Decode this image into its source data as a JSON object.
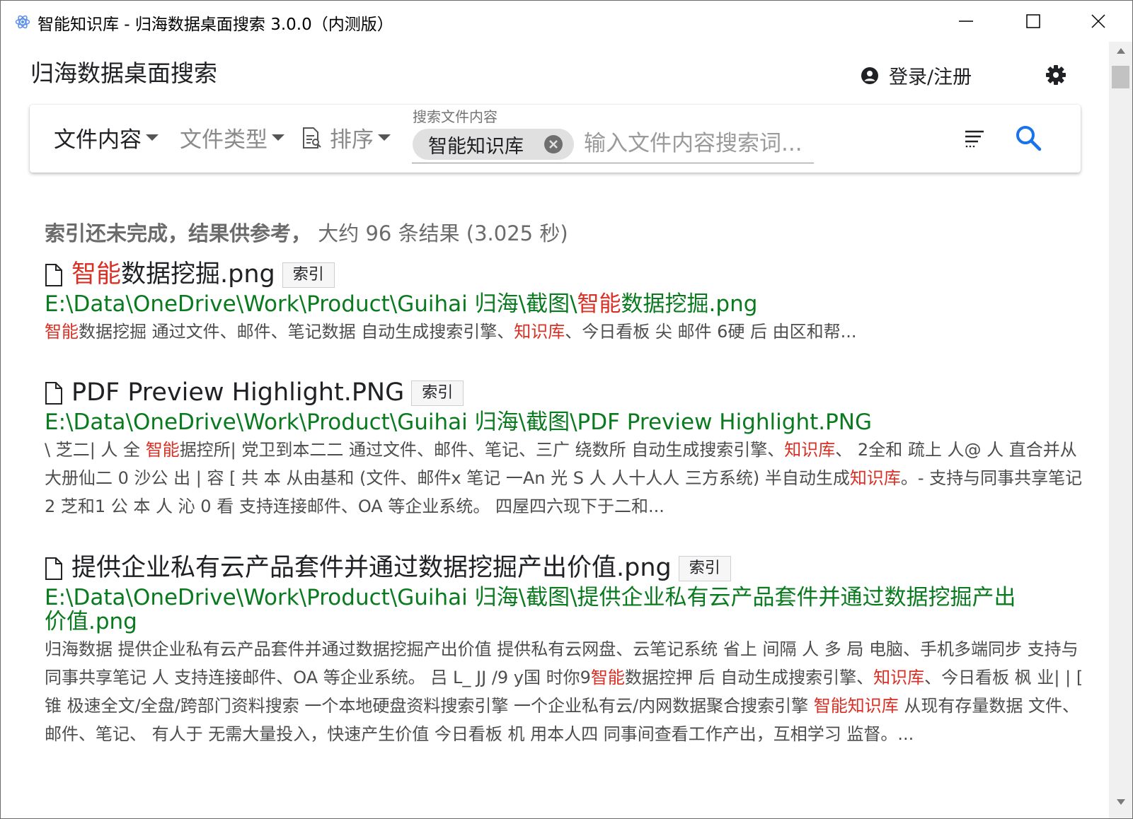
{
  "window": {
    "title": "智能知识库 - 归海数据桌面搜索 3.0.0（内测版）"
  },
  "header": {
    "app_name": "归海数据桌面搜索",
    "login_label": "登录/注册"
  },
  "search": {
    "filter_content": "文件内容",
    "filter_type": "文件类型",
    "filter_sort": "排序",
    "field_label": "搜索文件内容",
    "chip_text": "智能知识库",
    "placeholder": "输入文件内容搜索词..."
  },
  "summary": {
    "status": "索引还未完成，结果供参考，",
    "count_text": "大约 96 条结果 (3.025 秒)"
  },
  "colors": {
    "highlight": "#d93025",
    "path": "#0a7a1f",
    "accent": "#1a73e8"
  },
  "results": [
    {
      "title_hl": "智能",
      "title_rest": "数据挖掘.png",
      "tag": "索引",
      "path_pre": "E:\\Data\\OneDrive\\Work\\Product\\Guihai 归海\\截图\\",
      "path_hl": "智能",
      "path_post": "数据挖掘.png",
      "s1_hl": "智能",
      "s1": "数据挖掘 通过文件、邮件、笔记数据 自动生成搜索引擎、",
      "s2_hl": "知识库",
      "s2": "、今日看板 尖 邮件 6硬 后 由区和帮..."
    },
    {
      "title": "PDF Preview Highlight.PNG",
      "tag": "索引",
      "path": "E:\\Data\\OneDrive\\Work\\Product\\Guihai 归海\\截图\\PDF Preview Highlight.PNG",
      "s1": "\\ 芝二| 人 全 ",
      "s1_hl": "智能",
      "s2": "据控所| 党卫到本二二 通过文件、邮件、笔记、三广 绕数所 自动生成搜索引擎、",
      "s2_hl": "知识库",
      "s3": "、 2全和 疏上 人@ 人 直合并从大册仙二 0 沙公 出 | 容 [ 共 本 从由基和 (文件、邮件x 笔记 一An 光 S 人 人十人人 三方系统) 半自动生成",
      "s3_hl": "知识库",
      "s4": "。- 支持与同事共享笔记 2 芝和1 公 本 人 沁 0 看 支持连接邮件、OA 等企业系统。 四屋四六现下于二和..."
    },
    {
      "title": "提供企业私有云产品套件并通过数据挖掘产出价值.png",
      "tag": "索引",
      "path_line1": "E:\\Data\\OneDrive\\Work\\Product\\Guihai 归海\\截图\\提供企业私有云产品套件并通过数据挖掘产出",
      "path_line2": "价值.png",
      "s1": "归海数据 提供企业私有云产品套件并通过数据挖掘产出价值 提供私有云网盘、云笔记系统 省上 间隔 人 多 局 电脑、手机多端同步 支持与同事共享笔记 人 支持连接邮件、OA 等企业系统。 吕 L_ JJ /9 y国 时你9",
      "s1_hl": "智能",
      "s2": "数据控押 后 自动生成搜索引擎、",
      "s2_hl": "知识库",
      "s3": "、今日看板 枫 业| | [ 锥 极速全文/全盘/跨部门资料搜索 一个本地硬盘资料搜索引擎 一个企业私有云/内网数据聚合搜索引擎 ",
      "s3_hl": "智能知识库",
      "s4": " 从现有存量数据 文件、邮件、笔记、 有人于 无需大量投入，快速产生价值 今日看板 机 用本人四 同事间查看工作产出，互相学习 监督。..."
    }
  ]
}
